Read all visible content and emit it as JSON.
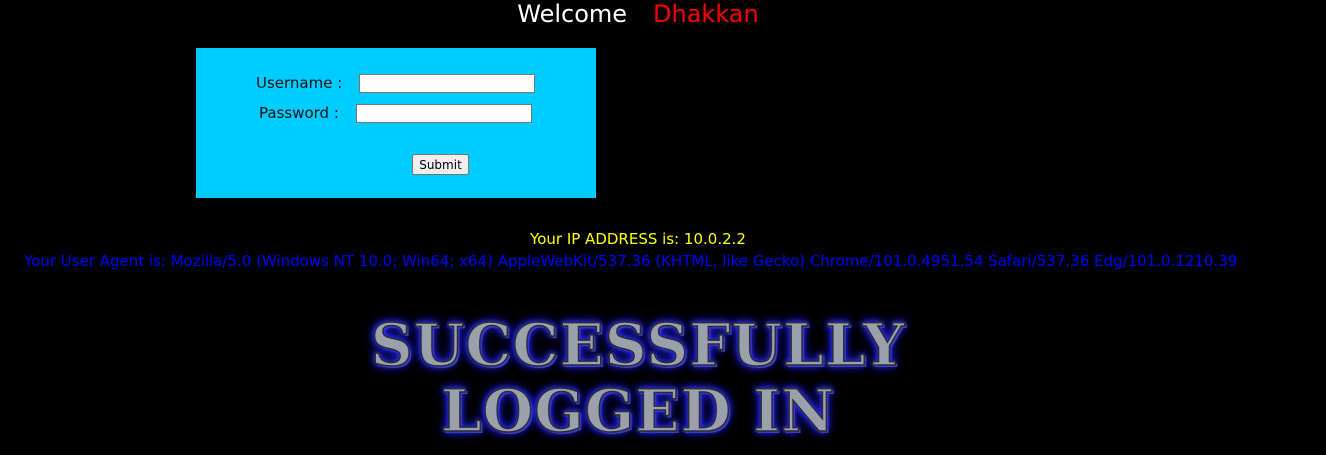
{
  "header": {
    "welcome": "Welcome",
    "name": "Dhakkan"
  },
  "login": {
    "username_label": "Username :",
    "username_value": "",
    "password_label": "Password :",
    "password_value": "",
    "submit_label": "Submit"
  },
  "info": {
    "ip": "Your IP ADDRESS is: 10.0.2.2",
    "user_agent": "Your User Agent is: Mozilla/5.0 (Windows NT 10.0; Win64; x64) AppleWebKit/537.36 (KHTML, like Gecko) Chrome/101.0.4951.54 Safari/537.36 Edg/101.0.1210.39"
  },
  "banner": {
    "line1": "SUCCESSFULLY",
    "line2": "LOGGED IN"
  },
  "colors": {
    "background": "#000000",
    "login_box": "#00ccff",
    "name": "#ff0000",
    "ip_text": "#ffff00",
    "ua_text": "#0000ff"
  }
}
